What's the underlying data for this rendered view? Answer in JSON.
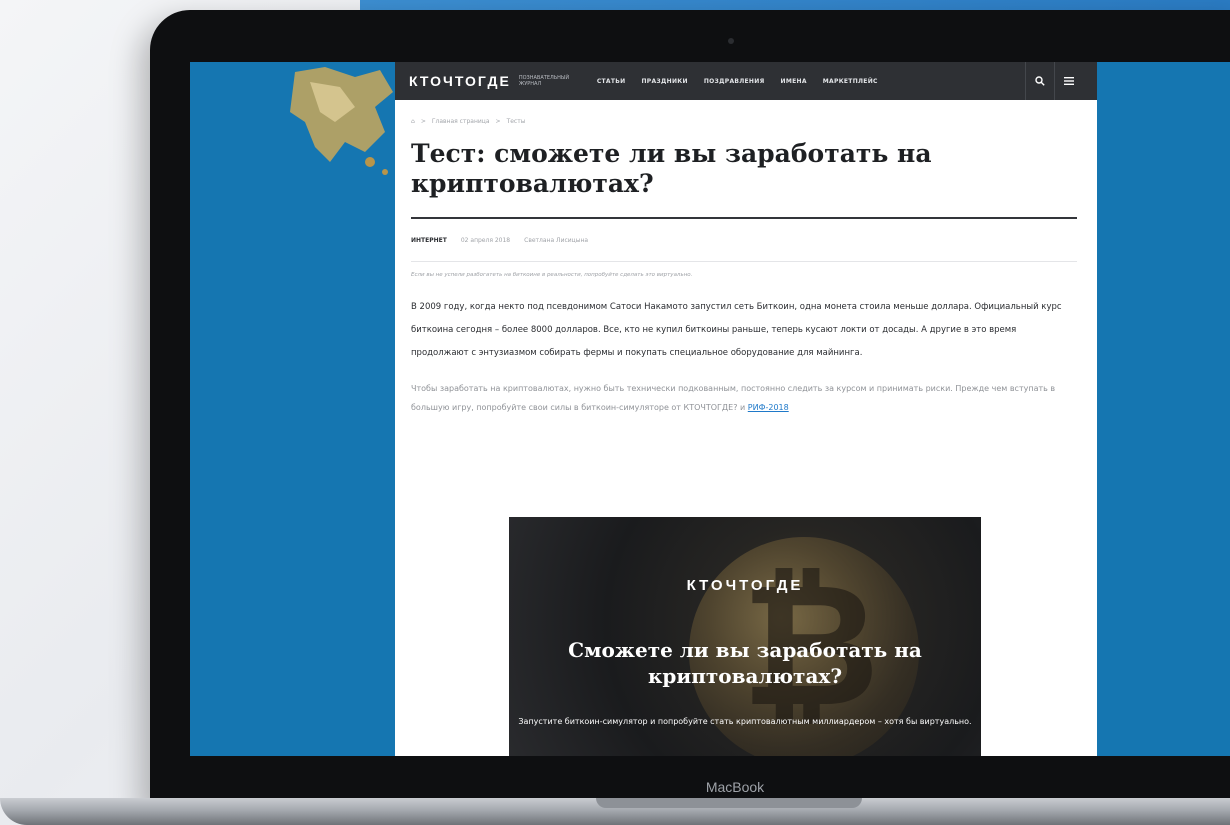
{
  "device": {
    "label": "MacBook"
  },
  "site": {
    "logo": "КТОЧТОГДЕ",
    "tagline": "ПОЗНАВАТЕЛЬНЫЙ ЖУРНАЛ",
    "nav": [
      "СТАТЬИ",
      "ПРАЗДНИКИ",
      "ПОЗДРАВЛЕНИЯ",
      "ИМЕНА",
      "МАРКЕТПЛЕЙС"
    ],
    "icons": [
      "search-icon",
      "menu-icon"
    ]
  },
  "breadcrumb": [
    "Главная страница",
    "Тесты"
  ],
  "article": {
    "title": "Тест: сможете ли вы заработать на криптовалютах?",
    "category": "ИНТЕРНЕТ",
    "date": "02 апреля 2018",
    "author": "Светлана Лисицына",
    "lead": "Если вы не успели разбогатеть на биткоине в реальности, попробуйте сделать это виртуально.",
    "paragraph1": "В 2009 году, когда некто под псевдонимом Сатоси Накамото запустил сеть Биткоин, одна монета стоила меньше доллара. Официальный курс биткоина сегодня – более 8000 долларов. Все, кто не купил биткоины раньше, теперь кусают локти от досады. А другие в это время продолжают с энтузиазмом собирать фермы и покупать специальное оборудование для майнинга.",
    "paragraph2_text": "Чтобы заработать на криптовалютах, нужно быть технически подкованным, постоянно следить за курсом и принимать риски. Прежде чем вступать в большую игру, попробуйте свои силы в биткоин-симуляторе от КТОЧТОГДЕ? и ",
    "paragraph2_link": "РИФ-2018"
  },
  "banner": {
    "logo": "КТОЧТОГДЕ",
    "title": "Сможете ли вы заработать на криптовалютах?",
    "subtitle": "Запустите биткоин-симулятор и попробуйте стать криптовалютным миллиардером – хотя бы виртуально."
  },
  "colors": {
    "screen_bg": "#1576b1",
    "topbar": "#2e3034",
    "link": "#1f79c9"
  }
}
